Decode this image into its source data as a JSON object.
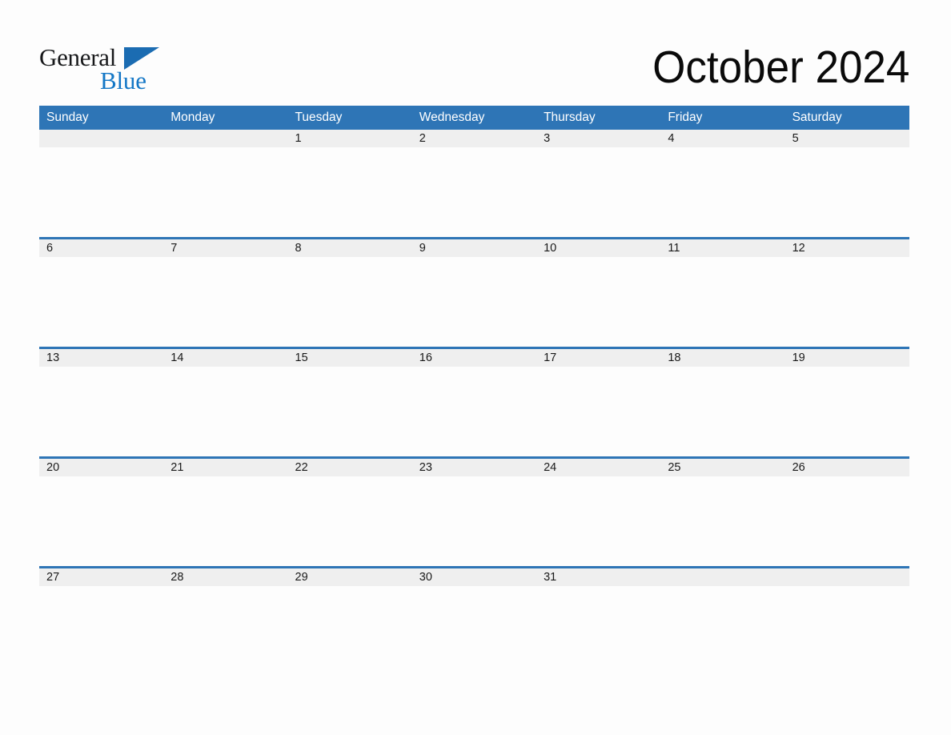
{
  "brand": {
    "name_part1": "General",
    "name_part2": "Blue",
    "logo_icon": "blue-triangle-icon",
    "colors": {
      "text_dark": "#17181A",
      "blue": "#1477C6",
      "triangle": "#1B6CB2"
    }
  },
  "header": {
    "title": "October 2024",
    "month": "October",
    "year": "2024"
  },
  "calendar": {
    "accent_color": "#2E75B6",
    "date_band_color": "#EFEFEF",
    "background_color": "#FDFDFD",
    "weekday_headers": [
      "Sunday",
      "Monday",
      "Tuesday",
      "Wednesday",
      "Thursday",
      "Friday",
      "Saturday"
    ],
    "weeks": [
      [
        "",
        "",
        "1",
        "2",
        "3",
        "4",
        "5"
      ],
      [
        "6",
        "7",
        "8",
        "9",
        "10",
        "11",
        "12"
      ],
      [
        "13",
        "14",
        "15",
        "16",
        "17",
        "18",
        "19"
      ],
      [
        "20",
        "21",
        "22",
        "23",
        "24",
        "25",
        "26"
      ],
      [
        "27",
        "28",
        "29",
        "30",
        "31",
        "",
        ""
      ]
    ]
  }
}
